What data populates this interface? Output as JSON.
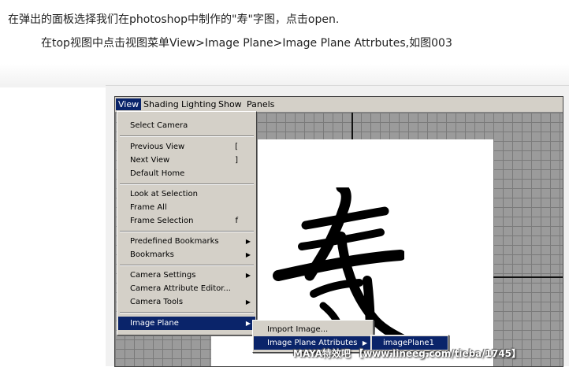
{
  "article": {
    "line1": "在弹出的面板选择我们在photoshop中制作的\"寿\"字图，点击open.",
    "line2": "在top视图中点击视图菜单View>Image Plane>Image Plane Attrbutes,如图003"
  },
  "menubar": {
    "items": [
      "View",
      "Shading",
      "Lighting",
      "Show",
      "Panels"
    ]
  },
  "view_menu": {
    "items": [
      {
        "label": "Select Camera",
        "shortcut": "",
        "submenu": false
      },
      {
        "label": "Previous View",
        "shortcut": "[",
        "submenu": false
      },
      {
        "label": "Next View",
        "shortcut": "]",
        "submenu": false
      },
      {
        "label": "Default Home",
        "shortcut": "",
        "submenu": false
      },
      {
        "label": "Look at Selection",
        "shortcut": "",
        "submenu": false
      },
      {
        "label": "Frame All",
        "shortcut": "",
        "submenu": false
      },
      {
        "label": "Frame Selection",
        "shortcut": "f",
        "submenu": false
      },
      {
        "label": "Predefined Bookmarks",
        "shortcut": "",
        "submenu": true
      },
      {
        "label": "Bookmarks",
        "shortcut": "",
        "submenu": true
      },
      {
        "label": "Camera Settings",
        "shortcut": "",
        "submenu": true
      },
      {
        "label": "Camera Attribute Editor...",
        "shortcut": "",
        "submenu": false
      },
      {
        "label": "Camera Tools",
        "shortcut": "",
        "submenu": true
      },
      {
        "label": "Image Plane",
        "shortcut": "",
        "submenu": true,
        "highlighted": true
      }
    ]
  },
  "image_plane_submenu": {
    "items": [
      {
        "label": "Import Image...",
        "submenu": false
      },
      {
        "label": "Image Plane Attributes",
        "submenu": true,
        "highlighted": true
      }
    ]
  },
  "attributes_submenu": {
    "items": [
      {
        "label": "imagePlane1",
        "highlighted": true
      }
    ]
  },
  "viewport": {
    "image_character": "寿"
  },
  "watermark": "MAYA特效吧 【www.lineeg.com/tieba/1745】",
  "icons": {
    "submenu_arrow": "submenu-arrow-icon"
  },
  "colors": {
    "menu_bg": "#d4d0c8",
    "highlight": "#0a246a",
    "viewport_grid": "#9b9b9b"
  }
}
